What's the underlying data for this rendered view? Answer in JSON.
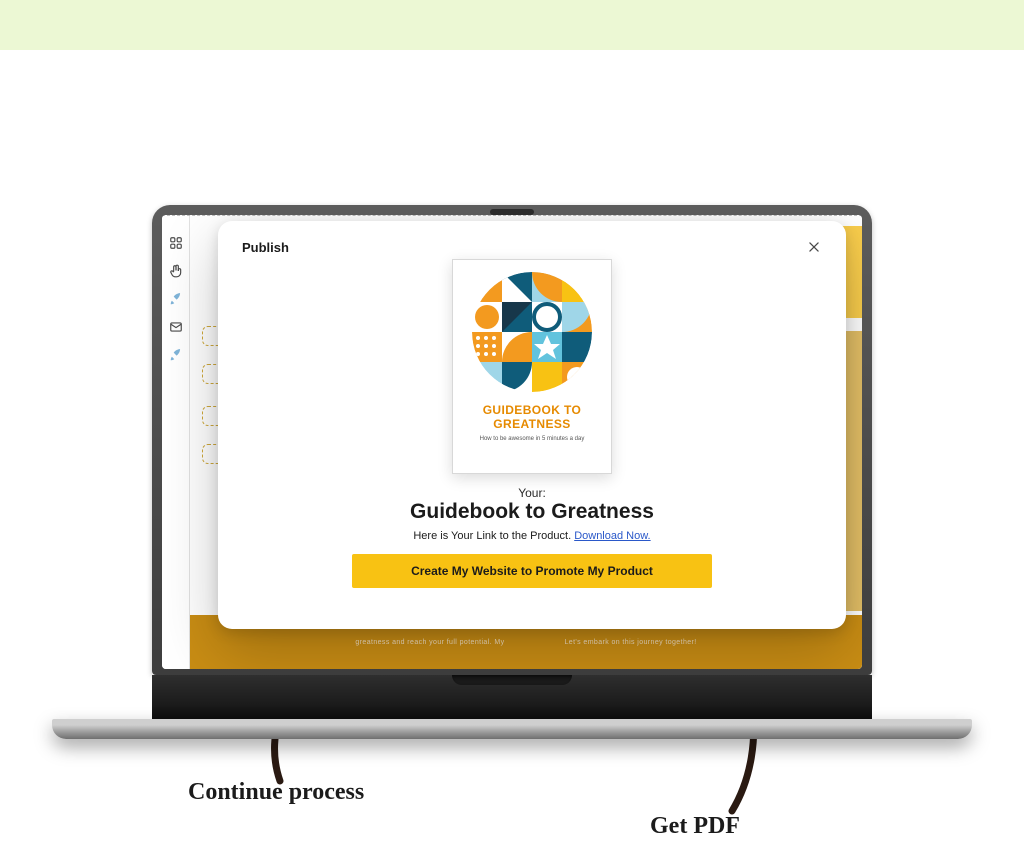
{
  "page": {
    "annotations": {
      "left": "Continue process",
      "right": "Get PDF"
    }
  },
  "backdrop": {
    "footer_left": "greatness and reach your full potential. My",
    "footer_right": "Let's embark on this journey together!"
  },
  "modal": {
    "title": "Publish",
    "cover": {
      "title_line1": "GUIDEBOOK TO",
      "title_line2": "GREATNESS",
      "subtitle": "How to be awesome in 5 minutes a day"
    },
    "your_label": "Your:",
    "product_name": "Guidebook to Greatness",
    "link_prefix": "Here is Your Link to the Product. ",
    "download_text": "Download Now.",
    "cta": "Create My Website to Promote My Product"
  },
  "colors": {
    "brand_yellow": "#f8c213",
    "brand_orange": "#e68a00"
  }
}
